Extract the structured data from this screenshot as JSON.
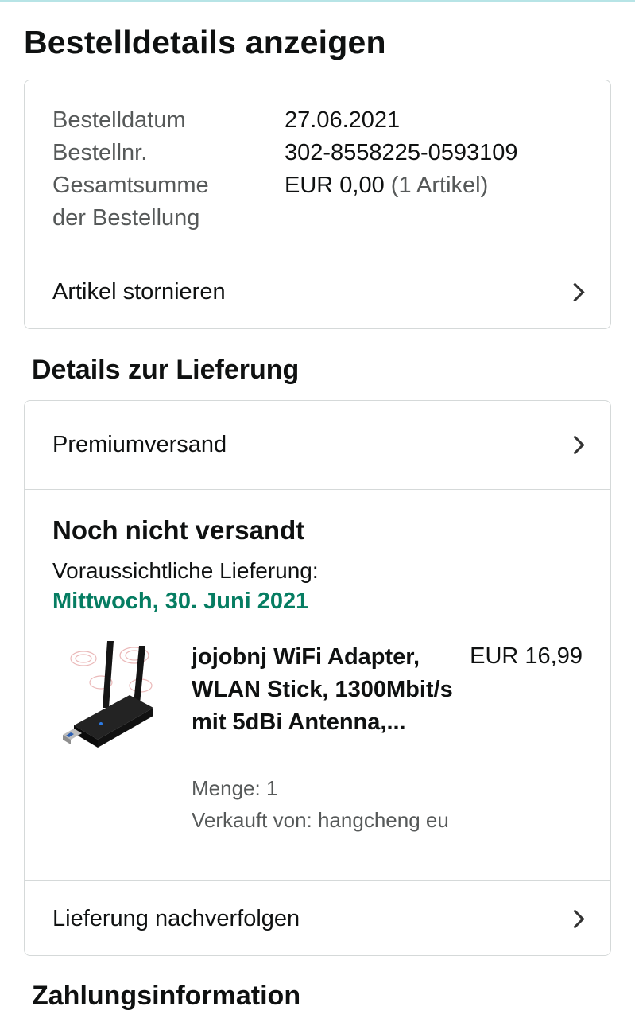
{
  "page_title": "Bestelldetails anzeigen",
  "order_summary": {
    "date_label": "Bestelldatum",
    "date_value": "27.06.2021",
    "number_label": "Bestellnr.",
    "number_value": "302-8558225-0593109",
    "total_label_line1": "Gesamtsumme",
    "total_label_line2": "der Bestellung",
    "total_value": "EUR 0,00",
    "total_items": "(1 Artikel)"
  },
  "cancel_items_label": "Artikel stornieren",
  "delivery_section_title": "Details zur Lieferung",
  "shipping_method": "Premiumversand",
  "shipment": {
    "status": "Noch nicht versandt",
    "eta_label": "Voraussichtliche Lieferung:",
    "eta_date": "Mittwoch, 30. Juni 2021",
    "product_title": "jojobnj WiFi Adapter, WLAN Stick, 1300Mbit/s mit 5dBi Antenna,...",
    "product_price": "EUR 16,99",
    "quantity": "Menge: 1",
    "seller": "Verkauft von: hangcheng eu"
  },
  "track_delivery_label": "Lieferung nachverfolgen",
  "payment_section_title": "Zahlungsinformation",
  "colors": {
    "eta_green": "#067d62",
    "border": "#d5d9d9",
    "muted_text": "#565959"
  },
  "icons": [
    "chevron-right-icon",
    "usb-wifi-adapter-product-image"
  ]
}
